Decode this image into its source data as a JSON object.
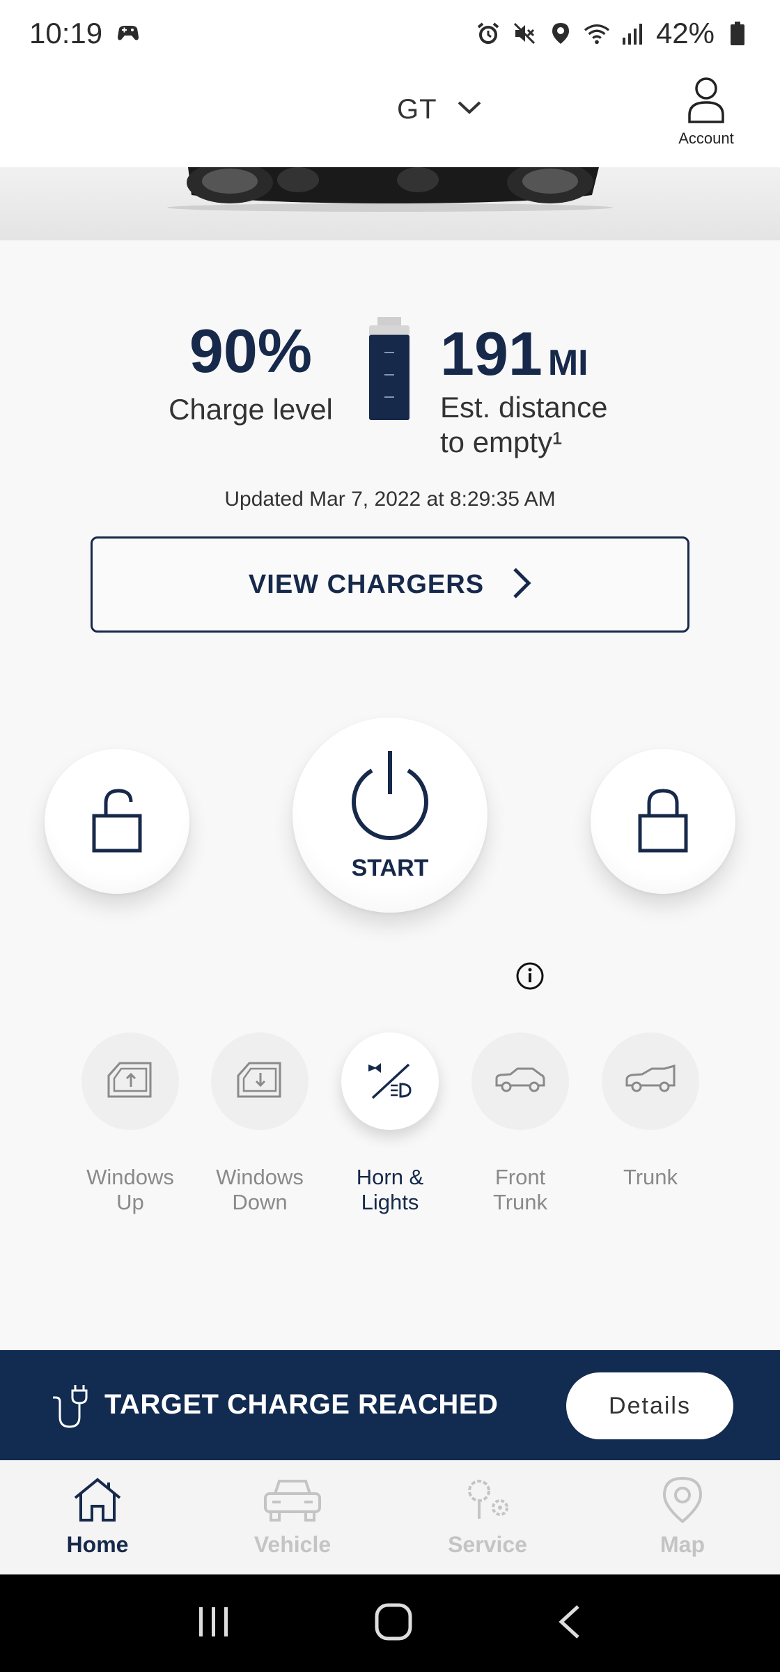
{
  "status_bar": {
    "time": "10:19",
    "battery_pct": "42%",
    "icons": [
      "gamepad-icon",
      "alarm-icon",
      "mute-icon",
      "location-icon",
      "wifi-icon",
      "signal-icon",
      "battery-icon"
    ]
  },
  "header": {
    "vehicle_name": "GT",
    "account_label": "Account"
  },
  "charge": {
    "level_value": "90%",
    "level_label": "Charge level",
    "range_value": "191",
    "range_unit": "MI",
    "range_label_line1": "Est. distance",
    "range_label_line2": "to empty¹",
    "updated_text": "Updated Mar 7, 2022 at 8:29:35 AM",
    "battery_fill_fraction": 0.9
  },
  "view_chargers": {
    "label": "VIEW CHARGERS"
  },
  "remote": {
    "start_label": "START"
  },
  "quick_actions": [
    {
      "line1": "Windows",
      "line2": "Up",
      "active": false
    },
    {
      "line1": "Windows",
      "line2": "Down",
      "active": false
    },
    {
      "line1": "Horn &",
      "line2": "Lights",
      "active": true
    },
    {
      "line1": "Front",
      "line2": "Trunk",
      "active": false
    },
    {
      "line1": "Trunk",
      "line2": "",
      "active": false
    }
  ],
  "banner": {
    "title": "TARGET CHARGE REACHED",
    "details_label": "Details"
  },
  "bottom_nav": [
    {
      "label": "Home",
      "active": true
    },
    {
      "label": "Vehicle",
      "active": false
    },
    {
      "label": "Service",
      "active": false
    },
    {
      "label": "Map",
      "active": false
    }
  ],
  "colors": {
    "primary": "#17294a",
    "banner": "#122b51",
    "inactive": "#c4c4c4"
  }
}
